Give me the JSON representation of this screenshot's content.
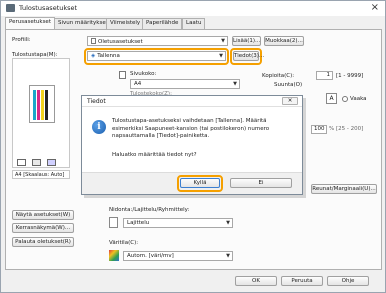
{
  "window": {
    "title": "Tulostusasetukset"
  },
  "tabs": [
    "Perusasetukset",
    "Sivun määritykset",
    "Viimeistely",
    "Paperilähde",
    "Laatu"
  ],
  "profile": {
    "label": "Profiili:",
    "value": "Oletusasetukset",
    "add_button": "Lisää(1)...",
    "edit_button": "Muokkaa(2)..."
  },
  "output": {
    "label": "Tulostustapa(M):",
    "value": "Tallenna",
    "details_button": "Tiedot(3)..."
  },
  "original_size": {
    "label": "Sivukoko:",
    "value": "A4"
  },
  "output_size_label": "Tulostekoko(Z):",
  "copies": {
    "label": "Kopioita(C):",
    "value": "1",
    "range": "[1 - 9999]",
    "orientation_label": "Suunta(O)"
  },
  "orientation": {
    "landscape": "Vaaka"
  },
  "scaling": {
    "value": "100",
    "range": "% [25 - 200]"
  },
  "preview": {
    "status": "A4 [Skaalaus: Auto]"
  },
  "preview_buttons": [
    "Näytä asetukset(W)",
    "Kerrasnäkymä(W)...",
    "Palauta oletukset(R)"
  ],
  "binding": {
    "label": "Nidonta:/Lajittelu/Ryhmittely:",
    "value": "Lajittelu"
  },
  "color": {
    "label": "Väritila(C):",
    "value": "Autom. [väri/mv]"
  },
  "margin_button": "Reunat/Marginaali(U)...",
  "footer": {
    "ok": "OK",
    "cancel": "Peruuta",
    "help": "Ohje"
  },
  "dialog": {
    "title": "Tiedot",
    "message": "Tulostustapa-asetukseksi vaihdetaan [Tallenna]. Määritä esimerkiksi Saapuneet-kansion (tai postilokeron) numero napsauttamalla [Tiedot]-painiketta.",
    "question": "Haluatko määrittää tiedot nyt?",
    "yes": "Kyllä",
    "no": "Ei",
    "close": "✕"
  }
}
